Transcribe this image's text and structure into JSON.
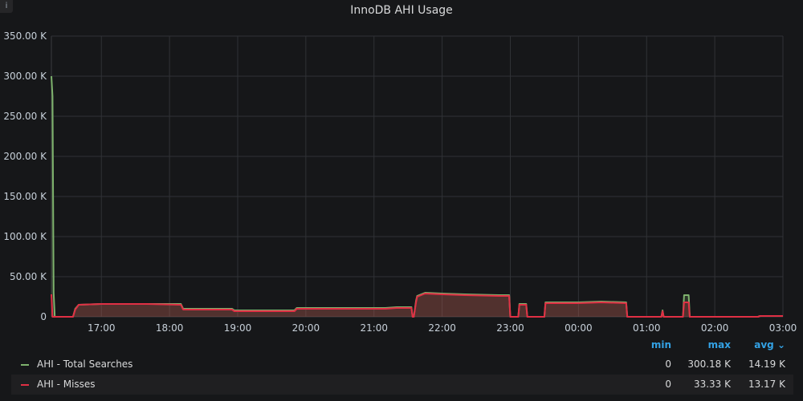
{
  "panel": {
    "title": "InnoDB AHI Usage",
    "info_glyph": "i"
  },
  "legend": {
    "columns": [
      "min",
      "max",
      "avg ⌄"
    ],
    "rows": [
      {
        "name": "AHI - Total Searches",
        "color": "#7eb26d",
        "min": "0",
        "max": "300.18 K",
        "avg": "14.19 K"
      },
      {
        "name": "AHI - Misses",
        "color": "#e02f44",
        "min": "0",
        "max": "33.33 K",
        "avg": "13.17 K"
      }
    ]
  },
  "chart_data": {
    "type": "area",
    "title": "InnoDB AHI Usage",
    "x_axis": {
      "type": "time",
      "range": [
        "16:16",
        "03:00"
      ],
      "tick_labels": [
        "17:00",
        "18:00",
        "19:00",
        "20:00",
        "21:00",
        "22:00",
        "23:00",
        "00:00",
        "01:00",
        "02:00",
        "03:00"
      ]
    },
    "y_axis": {
      "range": [
        0,
        350000
      ],
      "tick_labels": [
        "0",
        "50.00 K",
        "100.00 K",
        "150.00 K",
        "200.00 K",
        "250.00 K",
        "300.00 K",
        "350.00 K"
      ]
    },
    "grid": true,
    "legend_position": "bottom",
    "series": [
      {
        "name": "AHI - Total Searches",
        "color": "#7eb26d",
        "points": [
          [
            "16:16",
            300000
          ],
          [
            "16:17",
            275000
          ],
          [
            "16:18",
            30000
          ],
          [
            "16:19",
            0
          ],
          [
            "16:35",
            0
          ],
          [
            "16:37",
            10000
          ],
          [
            "16:40",
            15000
          ],
          [
            "17:00",
            16000
          ],
          [
            "17:40",
            16000
          ],
          [
            "18:10",
            16000
          ],
          [
            "18:12",
            10000
          ],
          [
            "18:55",
            10000
          ],
          [
            "18:57",
            8000
          ],
          [
            "19:50",
            8000
          ],
          [
            "19:52",
            11000
          ],
          [
            "21:10",
            11000
          ],
          [
            "21:20",
            12000
          ],
          [
            "21:33",
            12000
          ],
          [
            "21:34",
            0
          ],
          [
            "21:35",
            0
          ],
          [
            "21:37",
            20000
          ],
          [
            "21:38",
            26000
          ],
          [
            "21:45",
            30000
          ],
          [
            "22:00",
            29000
          ],
          [
            "22:20",
            28000
          ],
          [
            "22:50",
            27000
          ],
          [
            "22:59",
            27000
          ],
          [
            "23:00",
            0
          ],
          [
            "23:07",
            0
          ],
          [
            "23:08",
            16000
          ],
          [
            "23:14",
            16000
          ],
          [
            "23:15",
            0
          ],
          [
            "23:30",
            0
          ],
          [
            "23:31",
            18000
          ],
          [
            "00:00",
            18000
          ],
          [
            "00:20",
            19000
          ],
          [
            "00:42",
            18000
          ],
          [
            "00:43",
            0
          ],
          [
            "01:13",
            0
          ],
          [
            "01:14",
            8000
          ],
          [
            "01:15",
            0
          ],
          [
            "01:32",
            0
          ],
          [
            "01:33",
            27000
          ],
          [
            "01:37",
            27000
          ],
          [
            "01:38",
            0
          ],
          [
            "02:38",
            0
          ],
          [
            "02:40",
            1000
          ],
          [
            "03:00",
            1000
          ]
        ]
      },
      {
        "name": "AHI - Misses",
        "color": "#e02f44",
        "points": [
          [
            "16:16",
            28000
          ],
          [
            "16:17",
            0
          ],
          [
            "16:35",
            0
          ],
          [
            "16:37",
            9000
          ],
          [
            "16:40",
            15000
          ],
          [
            "17:00",
            16000
          ],
          [
            "17:40",
            16000
          ],
          [
            "18:10",
            15000
          ],
          [
            "18:12",
            9000
          ],
          [
            "18:55",
            9000
          ],
          [
            "18:57",
            7000
          ],
          [
            "19:50",
            7000
          ],
          [
            "19:52",
            10000
          ],
          [
            "21:10",
            10000
          ],
          [
            "21:20",
            11000
          ],
          [
            "21:33",
            11000
          ],
          [
            "21:34",
            0
          ],
          [
            "21:35",
            0
          ],
          [
            "21:37",
            18000
          ],
          [
            "21:38",
            25000
          ],
          [
            "21:45",
            29000
          ],
          [
            "22:00",
            28000
          ],
          [
            "22:20",
            27000
          ],
          [
            "22:50",
            26000
          ],
          [
            "22:59",
            26000
          ],
          [
            "23:00",
            0
          ],
          [
            "23:07",
            0
          ],
          [
            "23:08",
            15000
          ],
          [
            "23:14",
            15000
          ],
          [
            "23:15",
            0
          ],
          [
            "23:30",
            0
          ],
          [
            "23:31",
            17000
          ],
          [
            "00:00",
            17000
          ],
          [
            "00:20",
            18000
          ],
          [
            "00:42",
            17000
          ],
          [
            "00:43",
            0
          ],
          [
            "01:13",
            0
          ],
          [
            "01:14",
            7000
          ],
          [
            "01:15",
            0
          ],
          [
            "01:32",
            0
          ],
          [
            "01:33",
            18000
          ],
          [
            "01:37",
            18000
          ],
          [
            "01:38",
            0
          ],
          [
            "02:38",
            0
          ],
          [
            "02:40",
            1000
          ],
          [
            "03:00",
            1000
          ]
        ]
      }
    ]
  }
}
